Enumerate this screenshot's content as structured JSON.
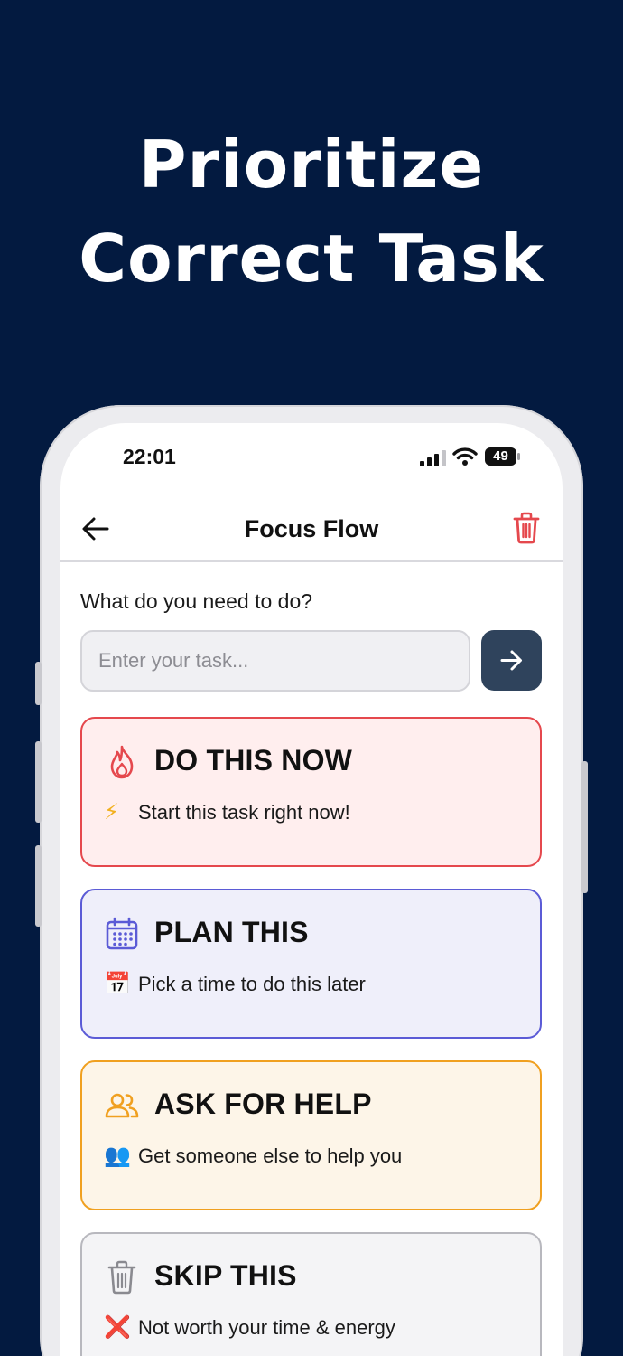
{
  "headline": {
    "line1": "Prioritize",
    "line2": "Correct Task"
  },
  "status_bar": {
    "time": "22:01",
    "battery": "49"
  },
  "navbar": {
    "title": "Focus Flow"
  },
  "task_entry": {
    "prompt": "What do you need to do?",
    "placeholder": "Enter your task...",
    "value": ""
  },
  "cards": [
    {
      "title": "DO THIS NOW",
      "icon": "flame-icon",
      "emoji": "⚡",
      "subtitle": "Start this task right now!",
      "border": "#e5484d",
      "bg": "#ffeeee",
      "accent": "#e5484d"
    },
    {
      "title": "PLAN THIS",
      "icon": "calendar-icon",
      "emoji": "📅",
      "subtitle": "Pick a time to do this later",
      "border": "#5b5bd6",
      "bg": "#efeffa",
      "accent": "#5b5bd6"
    },
    {
      "title": "ASK FOR HELP",
      "icon": "people-icon",
      "emoji": "👥",
      "subtitle": "Get someone else to help you",
      "border": "#f0a020",
      "bg": "#fdf5e8",
      "accent": "#f0a020"
    },
    {
      "title": "SKIP THIS",
      "icon": "trash-icon",
      "emoji": "❌",
      "subtitle": "Not worth your time & energy",
      "border": "#b8b8be",
      "bg": "#f4f4f6",
      "accent": "#8a8a90"
    }
  ],
  "colors": {
    "background": "#031a40",
    "submit_button": "#2f435c",
    "delete_icon": "#e5484d"
  }
}
